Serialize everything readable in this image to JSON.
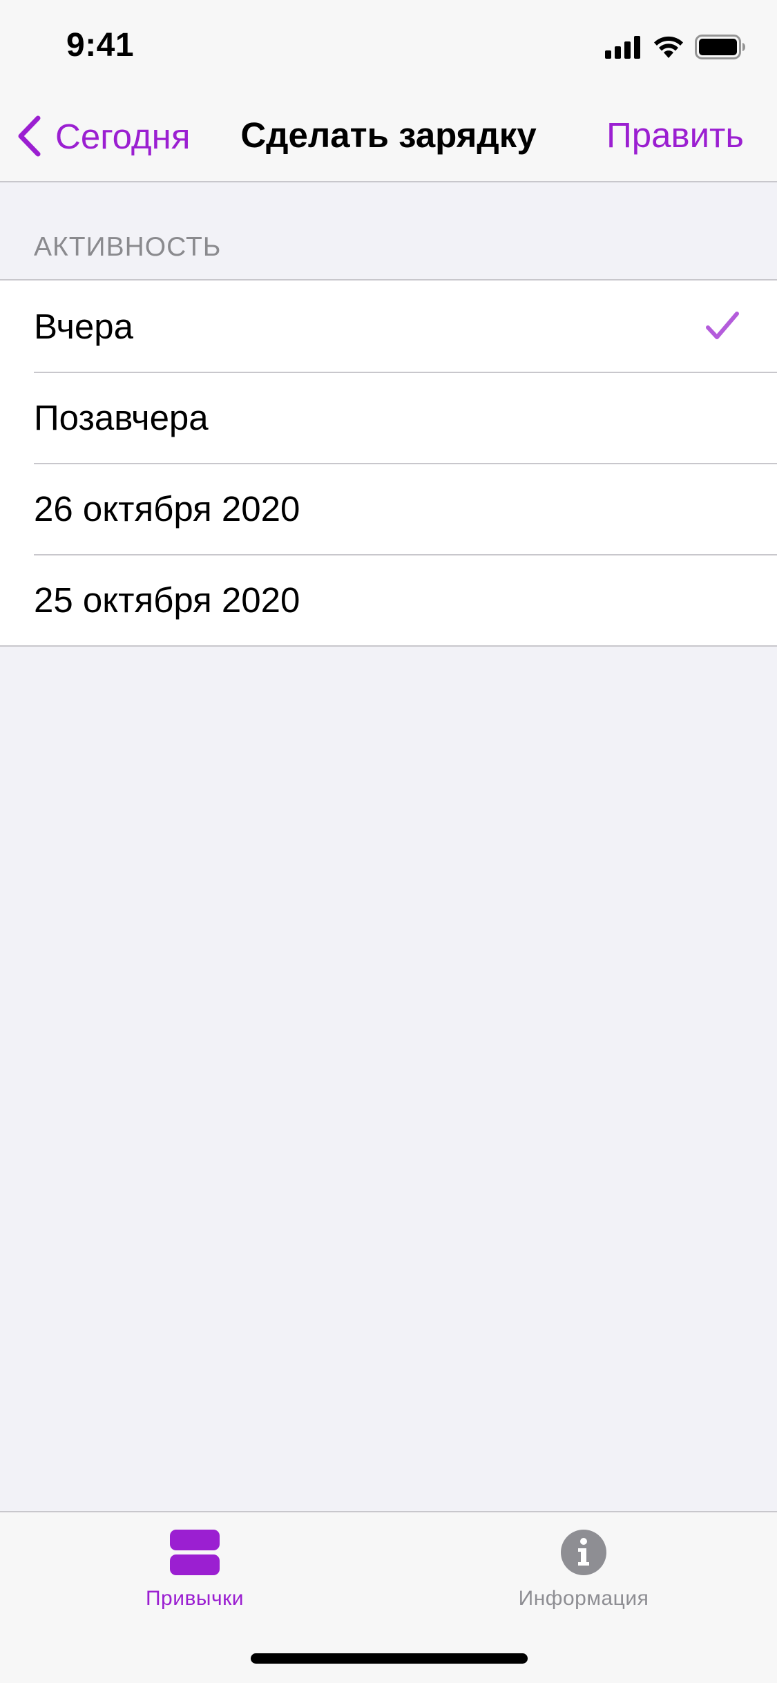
{
  "status_bar": {
    "time": "9:41",
    "icons": [
      "signal-icon",
      "wifi-icon",
      "battery-icon"
    ]
  },
  "nav": {
    "back_label": "Сегодня",
    "title": "Сделать зарядку",
    "edit_label": "Править"
  },
  "section": {
    "header": "АКТИВНОСТЬ",
    "items": [
      {
        "label": "Вчера",
        "checked": true
      },
      {
        "label": "Позавчера",
        "checked": false
      },
      {
        "label": "26 октября 2020",
        "checked": false
      },
      {
        "label": "25 октября 2020",
        "checked": false
      }
    ]
  },
  "tabs": [
    {
      "label": "Привычки",
      "icon": "habits-icon",
      "active": true
    },
    {
      "label": "Информация",
      "icon": "info-icon",
      "active": false
    }
  ],
  "colors": {
    "accent": "#9B1FD1",
    "checkmark": "#B45CDB",
    "background": "#F2F2F7",
    "separator": "#C8C7CC",
    "secondary_text": "#8A8A8E"
  }
}
